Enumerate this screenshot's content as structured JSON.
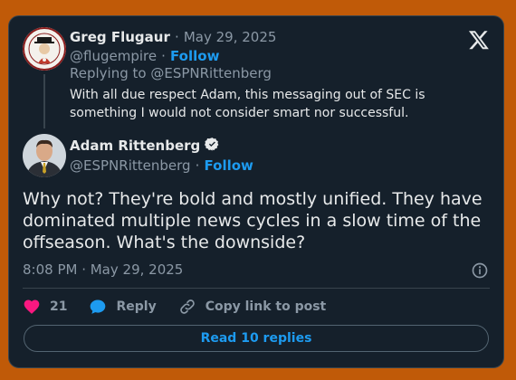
{
  "reply_tweet": {
    "author_name": "Greg Flugaur",
    "separator": "·",
    "date": "May 29, 2025",
    "handle": "@flugempire",
    "follow_label": "Follow",
    "replying_to_prefix": "Replying to",
    "replying_to_handle": "@ESPNRittenberg",
    "text": "With all due respect Adam, this messaging out of SEC is something I would not consider smart nor successful."
  },
  "main_tweet": {
    "author_name": "Adam Rittenberg",
    "verified": true,
    "handle": "@ESPNRittenberg",
    "separator": "·",
    "follow_label": "Follow",
    "text": "Why not? They're bold and mostly unified. They have dominated multiple news cycles in a slow time of the offseason. What's the downside?",
    "timestamp": "8:08 PM · May 29, 2025"
  },
  "actions": {
    "like_count": "21",
    "reply_label": "Reply",
    "copy_link_label": "Copy link to post"
  },
  "read_replies_label": "Read 10 replies",
  "icons": {
    "x_logo": "x-logo-icon",
    "verified": "verified-badge-icon",
    "info": "info-icon",
    "like": "heart-icon",
    "reply": "reply-bubble-icon",
    "copy_link": "link-icon"
  },
  "colors": {
    "page_bg": "#c05a08",
    "card_bg": "#15202b",
    "accent": "#1d9bf0",
    "like": "#f91880",
    "muted": "#8b98a5"
  }
}
